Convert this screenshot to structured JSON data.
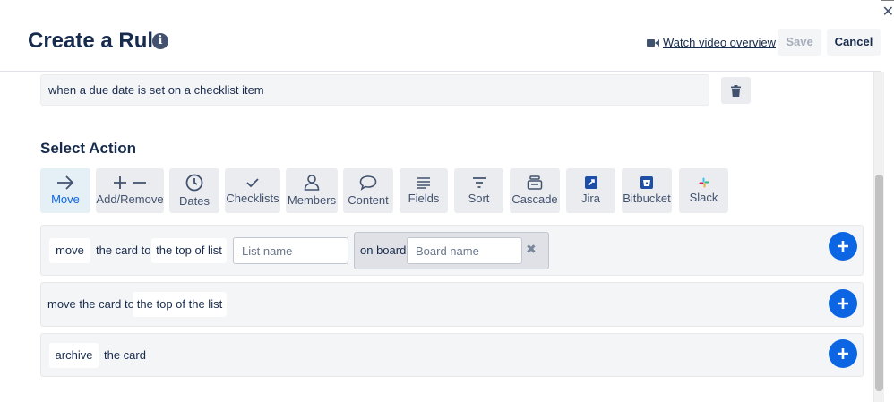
{
  "header": {
    "title": "Create a Rule",
    "info_icon": "info-icon",
    "video_link": "Watch video overview",
    "save_label": "Save",
    "cancel_label": "Cancel"
  },
  "trigger": {
    "text": "when a due date is set on a checklist item"
  },
  "select_action": {
    "title": "Select Action",
    "tabs": [
      {
        "label": "Move",
        "icon": "arrow-right-icon",
        "active": true
      },
      {
        "label": "Add/Remove",
        "icon": "plus-minus-icon"
      },
      {
        "label": "Dates",
        "icon": "clock-icon"
      },
      {
        "label": "Checklists",
        "icon": "checkmark-icon"
      },
      {
        "label": "Members",
        "icon": "person-icon"
      },
      {
        "label": "Content",
        "icon": "speech-bubble-icon"
      },
      {
        "label": "Fields",
        "icon": "lines-icon"
      },
      {
        "label": "Sort",
        "icon": "sort-icon"
      },
      {
        "label": "Cascade",
        "icon": "stack-icon"
      },
      {
        "label": "Jira",
        "icon": "jira-icon"
      },
      {
        "label": "Bitbucket",
        "icon": "bitbucket-icon"
      },
      {
        "label": "Slack",
        "icon": "slack-icon"
      }
    ]
  },
  "actions": [
    {
      "chip_move": "move",
      "text_card_to": "the card to",
      "chip_position": "the top of list",
      "list_placeholder": "List name",
      "on_board": "on board",
      "board_placeholder": "Board name"
    },
    {
      "text": "move the card to",
      "chip_position": "the top of the list"
    },
    {
      "chip_archive": "archive",
      "text": "the card"
    }
  ],
  "colors": {
    "primary": "#0c66e4",
    "text": "#172b4d",
    "muted": "#42526e",
    "panel": "#f4f5f7"
  }
}
